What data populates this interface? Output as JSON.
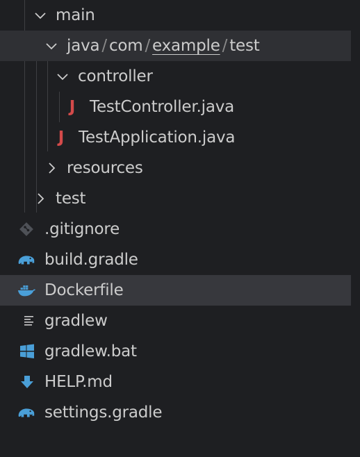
{
  "tree": {
    "main_folder": {
      "label": "main",
      "expanded": true
    },
    "java_path": {
      "segments": [
        "java",
        "com",
        "example",
        "test"
      ],
      "separator": "/",
      "expanded": true
    },
    "controller_folder": {
      "label": "controller",
      "expanded": true
    },
    "test_controller_file": {
      "label": "TestController.java",
      "icon": "java-icon",
      "icon_text": "J"
    },
    "test_application_file": {
      "label": "TestApplication.java",
      "icon": "java-icon",
      "icon_text": "J"
    },
    "resources_folder": {
      "label": "resources",
      "expanded": false
    },
    "test_folder": {
      "label": "test",
      "expanded": false
    },
    "gitignore_file": {
      "label": ".gitignore",
      "icon": "git-icon"
    },
    "build_gradle_file": {
      "label": "build.gradle",
      "icon": "gradle-elephant-icon"
    },
    "dockerfile_file": {
      "label": "Dockerfile",
      "icon": "docker-whale-icon"
    },
    "gradlew_file": {
      "label": "gradlew",
      "icon": "text-lines-icon"
    },
    "gradlew_bat_file": {
      "label": "gradlew.bat",
      "icon": "windows-icon"
    },
    "help_file": {
      "label": "HELP.md",
      "icon": "download-arrow-icon"
    },
    "settings_gradle_file": {
      "label": "settings.gradle",
      "icon": "gradle-elephant-icon"
    }
  },
  "colors": {
    "background": "#1e1f22",
    "hover_row": "#2f3034",
    "selected_row": "#37383d",
    "text": "#cccccc",
    "java_icon": "#d44a4a",
    "blue_icon": "#4a9fd8"
  }
}
